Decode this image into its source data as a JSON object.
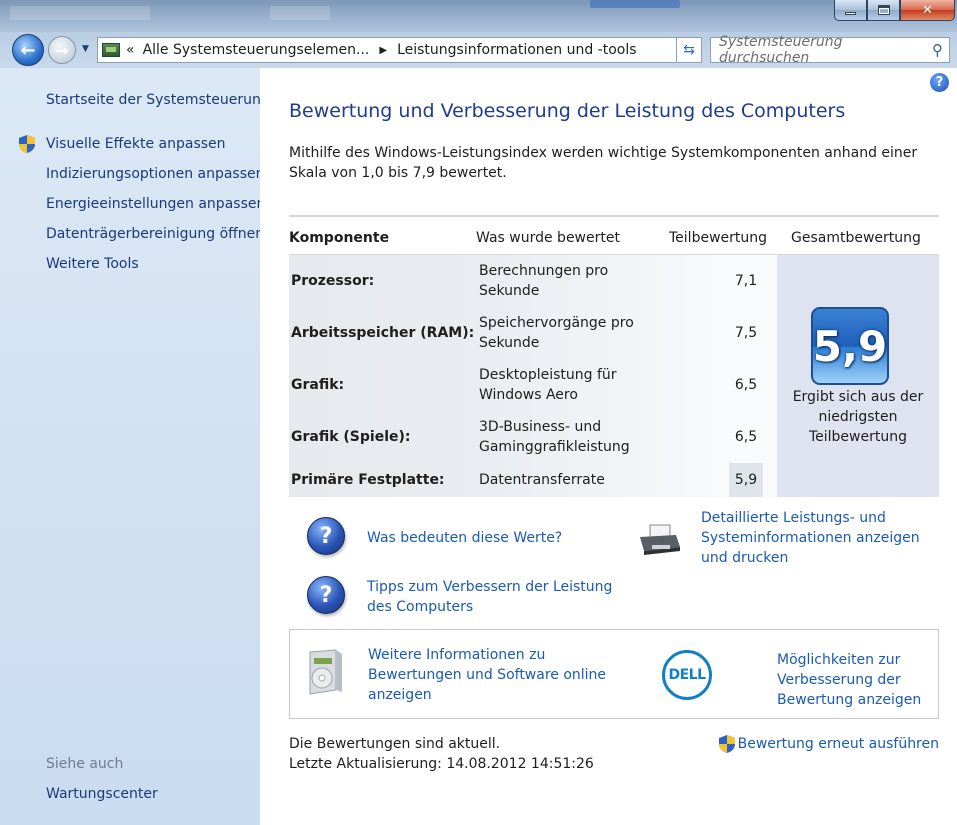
{
  "window": {
    "address": {
      "prefix": "«",
      "segment1": "Alle Systemsteuerungselemen...",
      "separator": "▶",
      "segment2": "Leistungsinformationen und -tools"
    },
    "search_placeholder": "Systemsteuerung durchsuchen"
  },
  "sidebar": {
    "home": "Startseite der Systemsteuerung",
    "items": [
      {
        "label": "Visuelle Effekte anpassen",
        "shield": true
      },
      {
        "label": "Indizierungsoptionen anpassen"
      },
      {
        "label": "Energieeinstellungen anpassen"
      },
      {
        "label": "Datenträgerbereinigung öffnen"
      },
      {
        "label": "Weitere Tools"
      }
    ],
    "see_also_title": "Siehe auch",
    "see_also_items": [
      "Wartungscenter"
    ]
  },
  "main": {
    "title": "Bewertung und Verbesserung der Leistung des Computers",
    "description": "Mithilfe des Windows-Leistungsindex werden wichtige Systemkomponenten anhand einer Skala von 1,0 bis 7,9 bewertet.",
    "table": {
      "headers": {
        "component": "Komponente",
        "rated": "Was wurde bewertet",
        "subscore": "Teilbewertung",
        "total": "Gesamtbewertung"
      },
      "rows": [
        {
          "component": "Prozessor:",
          "rated": "Berechnungen pro Sekunde",
          "score": "7,1"
        },
        {
          "component": "Arbeitsspeicher (RAM):",
          "rated": "Speichervorgänge pro Sekunde",
          "score": "7,5"
        },
        {
          "component": "Grafik:",
          "rated": "Desktopleistung für Windows Aero",
          "score": "6,5"
        },
        {
          "component": "Grafik (Spiele):",
          "rated": "3D-Business- und Gaminggrafikleistung",
          "score": "6,5"
        },
        {
          "component": "Primäre Festplatte:",
          "rated": "Datentransferrate",
          "score": "5,9"
        }
      ],
      "total_score": "5,9",
      "total_caption": "Ergibt sich aus der niedrigsten Teilbewertung"
    },
    "links": {
      "what_values_mean": "Was bedeuten diese Werte?",
      "tips": "Tipps zum Verbessern der Leistung des Computers",
      "details": "Detaillierte Leistungs- und Systeminformationen anzeigen und drucken"
    },
    "infobox": {
      "online_info": "Weitere Informationen zu Bewertungen und Software online anzeigen",
      "dell_logo_text": "DELL",
      "dell_link": "Möglichkeiten zur Verbesserung der Bewertung anzeigen"
    },
    "status": {
      "current": "Die Bewertungen sind aktuell.",
      "last_update": "Letzte Aktualisierung: 14.08.2012 14:51:26"
    },
    "rerun": "Bewertung erneut ausführen"
  }
}
